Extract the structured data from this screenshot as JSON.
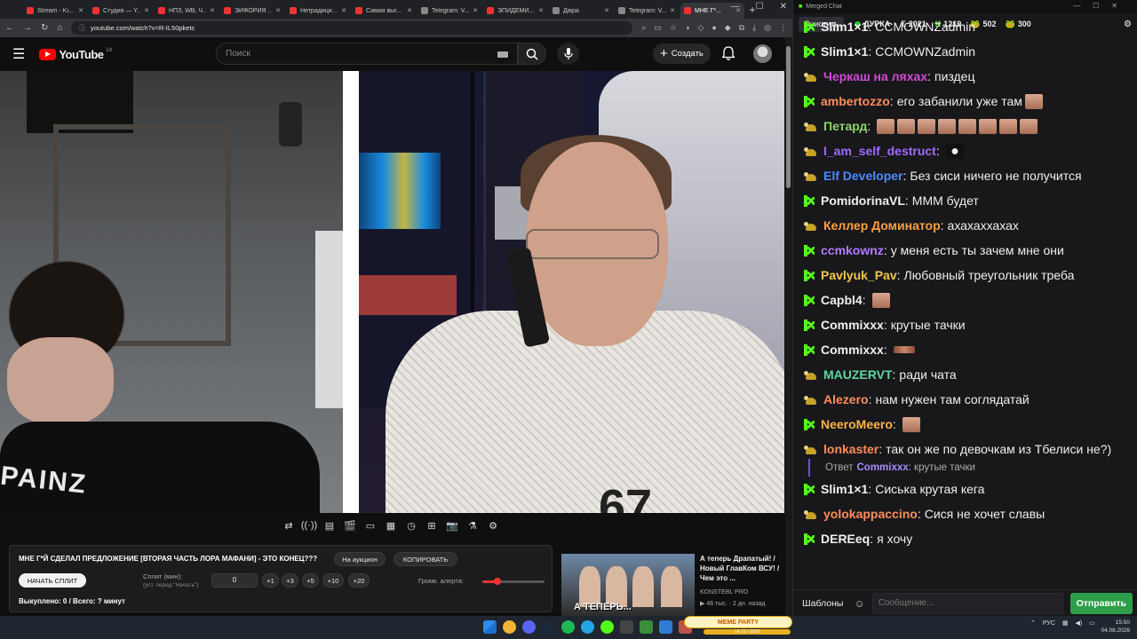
{
  "browser": {
    "tabs": [
      {
        "label": "Stream - Ki...",
        "color": "#e33"
      },
      {
        "label": "Студия — Y...",
        "color": "#e33"
      },
      {
        "label": "НПЗ, WB, Ч...",
        "color": "#e33"
      },
      {
        "label": "ЭЙФОРИЯ ...",
        "color": "#e33"
      },
      {
        "label": "Нетрадици...",
        "color": "#e33"
      },
      {
        "label": "Самая выг...",
        "color": "#e33"
      },
      {
        "label": "Telegram: V...",
        "color": "#888"
      },
      {
        "label": "ЭПИДЕМИ...",
        "color": "#e33"
      },
      {
        "label": "Дівра",
        "color": "#888"
      },
      {
        "label": "Telegram: V...",
        "color": "#888"
      },
      {
        "label": "МНЕ Г*...",
        "color": "#e33"
      }
    ],
    "url": "youtube.com/watch?v=R-IL50pketc",
    "nav": {
      "back": "←",
      "forward": "→",
      "reload": "↻",
      "home": "⌂"
    }
  },
  "youtube": {
    "logo_text": "YouTube",
    "logo_region": "LV",
    "search_placeholder": "Поиск",
    "create_label": "Создать"
  },
  "video": {
    "shirt_text": "PAINZ",
    "shirt_number": "67"
  },
  "player_toolbar": [
    "⇄",
    "((·))",
    "▤",
    "🎬",
    "▭",
    "▦",
    "◷",
    "⊞",
    "📷",
    "⚗",
    "⚙"
  ],
  "panel": {
    "title": "МНЕ Г*Й СДЕЛАЛ ПРЕДЛОЖЕНИЕ [ВТОРАЯ ЧАСТЬ ЛОРА МАФАНИ] - ЭТО КОНЕЦ???",
    "auction_label": "На аукцион",
    "copy_label": "КОПИРОВАТЬ",
    "split_button": "НАЧАТЬ СПЛИТ",
    "split_label": "Сплит (мин):",
    "split_hint": "(уст. перед \"Начать\")",
    "split_value": "0",
    "increments": [
      "+1",
      "+3",
      "+5",
      "+10",
      "+20"
    ],
    "volume_label": "Громк. алерта:",
    "volume_fraction": 0.24,
    "bought": "Выкуплено: 0 / Всего: ? минут"
  },
  "recommended": {
    "title": "А теперь Драпатый! / Новый ГлавКом ВСУ! / Чем это ...",
    "channel": "KONSTEBL PRO",
    "meta": "▶ 46 тыс. · 2 дн. назад",
    "thumb_caption": "А ТЕПЕРЬ..."
  },
  "chat": {
    "window_title": "Merged Chat",
    "clear_label": "Очистить",
    "channel": "ДУРКА",
    "stats": [
      {
        "icon": "Σ",
        "value": "2021",
        "color": "#eee"
      },
      {
        "icon": "K",
        "value": "1219",
        "color": "#53fc18"
      },
      {
        "icon": "🐸",
        "value": "502",
        "color": "#c9a227"
      },
      {
        "icon": "🐸",
        "value": "300",
        "color": "#53fc18"
      }
    ],
    "messages": [
      {
        "badge": "k",
        "user": "Slim1×1",
        "color": "#f0f0f0",
        "text": "CCMOWNZadmin",
        "emotes": 0
      },
      {
        "badge": "k",
        "user": "Slim1×1",
        "color": "#f0f0f0",
        "text": "CCMOWNZadmin",
        "emotes": 0
      },
      {
        "badge": "t",
        "user": "Черкаш на ляхах",
        "color": "#d24bd6",
        "text": "пиздец",
        "emotes": 0
      },
      {
        "badge": "k",
        "user": "ambertozzo",
        "color": "#ff8c5a",
        "text": "его забанили уже там",
        "emotes": 1
      },
      {
        "badge": "t",
        "user": "Петард",
        "color": "#8bd36a",
        "text": "",
        "emotes": 8
      },
      {
        "badge": "t",
        "user": "I_am_self_destruct",
        "color": "#a06aff",
        "text": "",
        "emotes": 1,
        "emote_kind": "mask"
      },
      {
        "badge": "t",
        "user": "Elf Developer",
        "color": "#4a8bff",
        "text": "Без сиси ничего не получится",
        "emotes": 0
      },
      {
        "badge": "k",
        "user": "PomidorinaVL",
        "color": "#f0f0f0",
        "text": "МММ будет",
        "emotes": 0
      },
      {
        "badge": "t",
        "user": "Келлер Доминатор",
        "color": "#ff9f40",
        "text": "ахахаххахах",
        "emotes": 0
      },
      {
        "badge": "k",
        "user": "ccmkownz",
        "color": "#b479ff",
        "text": "у меня есть ты зачем мне они",
        "emotes": 0
      },
      {
        "badge": "k",
        "user": "Pavlyuk_Pav",
        "color": "#f5c84a",
        "text": "Любовный треугольник треба",
        "emotes": 0
      },
      {
        "badge": "k",
        "user": "Capbl4",
        "color": "#f0f0f0",
        "text": "",
        "emotes": 1
      },
      {
        "badge": "k",
        "user": "Commixxx",
        "color": "#f0f0f0",
        "text": "крутые тачки",
        "emotes": 0
      },
      {
        "badge": "k",
        "user": "Commixxx",
        "color": "#f0f0f0",
        "text": "",
        "emotes": 1,
        "emote_kind": "bar"
      },
      {
        "badge": "t",
        "user": "MAUZERVT",
        "color": "#5fd6a0",
        "text": "ради чата",
        "emotes": 0
      },
      {
        "badge": "t",
        "user": "Alezero",
        "color": "#ff8c5a",
        "text": "нам нужен там соглядатай",
        "emotes": 0
      },
      {
        "badge": "k",
        "user": "NeeroMeero",
        "color": "#ffb347",
        "text": "",
        "emotes": 1
      },
      {
        "badge": "t",
        "user": "lonkaster",
        "color": "#ff8c5a",
        "text": "так он же по девочкам из Тбелиси не?)",
        "emotes": 0,
        "wrap": true
      },
      {
        "reply": true,
        "prefix": "Ответ",
        "ruser": "Commixxx",
        "rtext": "крутые тачки"
      },
      {
        "badge": "k",
        "user": "Slim1×1",
        "color": "#f0f0f0",
        "text": "Сиська крутая кега",
        "emotes": 0
      },
      {
        "badge": "t",
        "user": "yolokappaccino",
        "color": "#ff8c5a",
        "text": "Сися не хочет славы",
        "emotes": 0
      },
      {
        "badge": "k",
        "user": "DEREeq",
        "color": "#f0f0f0",
        "text": "я хочу",
        "emotes": 0
      }
    ],
    "templates_label": "Шаблоны",
    "input_placeholder": "Сообщение...",
    "send_label": "Отправить"
  },
  "taskbar": {
    "meme_label": "MEME PARTY",
    "meme_value": "14.72 / 1500",
    "language": "РУС",
    "time": "15:50",
    "date": "04.08.2026"
  }
}
